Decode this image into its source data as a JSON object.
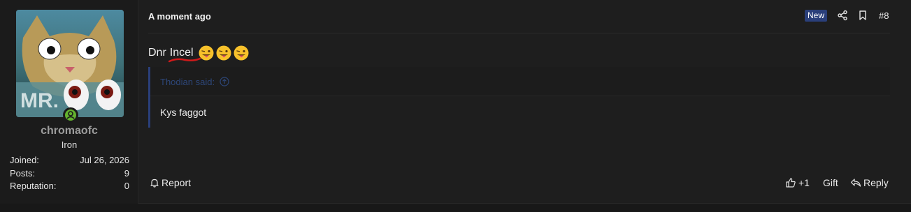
{
  "user": {
    "username": "chromaofc",
    "rank": "Iron",
    "stats": [
      {
        "key": "Joined:",
        "value": "Jul 26, 2026"
      },
      {
        "key": "Posts:",
        "value": "9"
      },
      {
        "key": "Reputation:",
        "value": "0"
      }
    ],
    "online_color": "#63b32e"
  },
  "post": {
    "time": "A moment ago",
    "badge": "New",
    "number": "#8",
    "message_prefix": "Dnr",
    "message_word": "Incel",
    "emoji_count": 3
  },
  "quote": {
    "author": "Thodian said:",
    "body": "Kys faggot"
  },
  "footer": {
    "report": "Report",
    "like": "+1",
    "gift": "Gift",
    "reply": "Reply"
  },
  "colors": {
    "accent": "#2a3f7a",
    "underline": "#d11a1a"
  }
}
